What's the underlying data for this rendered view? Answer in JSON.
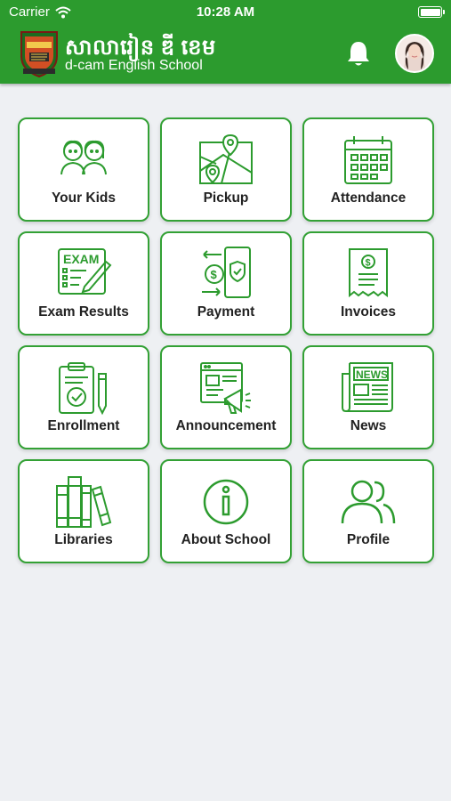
{
  "status": {
    "carrier": "Carrier",
    "time": "10:28 AM"
  },
  "header": {
    "title_khmer": "សាលារៀន ឌី ខេម",
    "title_english": "d-cam English School",
    "accent_color": "#2c9b2e"
  },
  "menu": [
    {
      "label": "Your Kids",
      "icon": "kids-icon"
    },
    {
      "label": "Pickup",
      "icon": "map-pin-icon"
    },
    {
      "label": "Attendance",
      "icon": "calendar-icon"
    },
    {
      "label": "Exam Results",
      "icon": "exam-icon",
      "icon_text": "EXAM"
    },
    {
      "label": "Payment",
      "icon": "payment-icon"
    },
    {
      "label": "Invoices",
      "icon": "invoice-icon"
    },
    {
      "label": "Enrollment",
      "icon": "clipboard-icon"
    },
    {
      "label": "Announcement",
      "icon": "megaphone-icon"
    },
    {
      "label": "News",
      "icon": "newspaper-icon",
      "icon_text": "NEWS"
    },
    {
      "label": "Libraries",
      "icon": "books-icon"
    },
    {
      "label": "About School",
      "icon": "info-icon"
    },
    {
      "label": "Profile",
      "icon": "users-icon"
    }
  ]
}
